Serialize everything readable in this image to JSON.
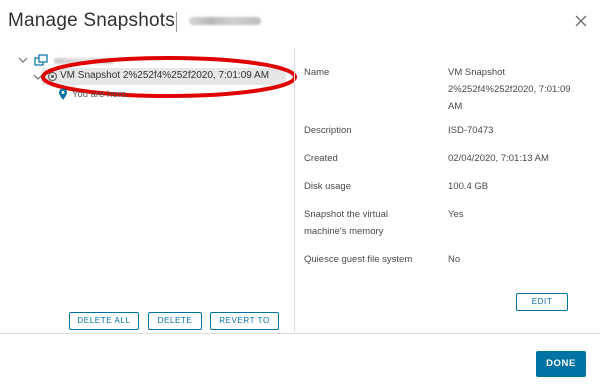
{
  "dialog": {
    "title": "Manage Snapshots",
    "close_label": "close"
  },
  "tree": {
    "snapshot_label": "VM Snapshot 2%252f4%252f2020, 7:01:09 AM",
    "here_label": "You are here"
  },
  "left_buttons": {
    "delete_all": "DELETE ALL",
    "delete": "DELETE",
    "revert_to": "REVERT TO"
  },
  "details": {
    "name_label": "Name",
    "name_value_1": "VM Snapshot",
    "name_value_2": "2%252f4%252f2020, 7:01:09",
    "name_value_3": "AM",
    "description_label": "Description",
    "description_value": "ISD-70473",
    "created_label": "Created",
    "created_value": "02/04/2020, 7:01:13 AM",
    "disk_usage_label": "Disk usage",
    "disk_usage_value": "100.4 GB",
    "snapshot_memory_label_1": "Snapshot the virtual",
    "snapshot_memory_label_2": "machine's memory",
    "snapshot_memory_value": "Yes",
    "quiesce_label": "Quiesce guest file system",
    "quiesce_value": "No",
    "edit_label": "EDIT"
  },
  "footer": {
    "done_label": "DONE"
  },
  "colors": {
    "accent": "#0072a3",
    "highlight_ellipse": "#e00000",
    "selected_row": "#e6e6e6"
  }
}
